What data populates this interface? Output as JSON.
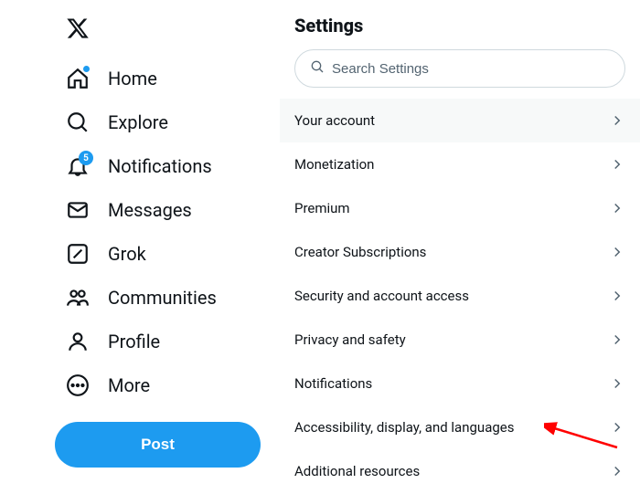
{
  "sidebar": {
    "items": [
      {
        "label": "Home",
        "icon": "home-icon",
        "has_dot": true
      },
      {
        "label": "Explore",
        "icon": "search-icon"
      },
      {
        "label": "Notifications",
        "icon": "bell-icon",
        "badge": "5"
      },
      {
        "label": "Messages",
        "icon": "mail-icon"
      },
      {
        "label": "Grok",
        "icon": "grok-icon"
      },
      {
        "label": "Communities",
        "icon": "people-icon"
      },
      {
        "label": "Profile",
        "icon": "profile-icon"
      },
      {
        "label": "More",
        "icon": "more-icon"
      }
    ],
    "post_label": "Post"
  },
  "settings": {
    "title": "Settings",
    "search_placeholder": "Search Settings",
    "items": [
      {
        "label": "Your account",
        "selected": true
      },
      {
        "label": "Monetization"
      },
      {
        "label": "Premium"
      },
      {
        "label": "Creator Subscriptions"
      },
      {
        "label": "Security and account access"
      },
      {
        "label": "Privacy and safety"
      },
      {
        "label": "Notifications"
      },
      {
        "label": "Accessibility, display, and languages"
      },
      {
        "label": "Additional resources"
      }
    ]
  },
  "annotation": {
    "arrow_target": "Accessibility, display, and languages",
    "arrow_color": "#ff0000"
  }
}
